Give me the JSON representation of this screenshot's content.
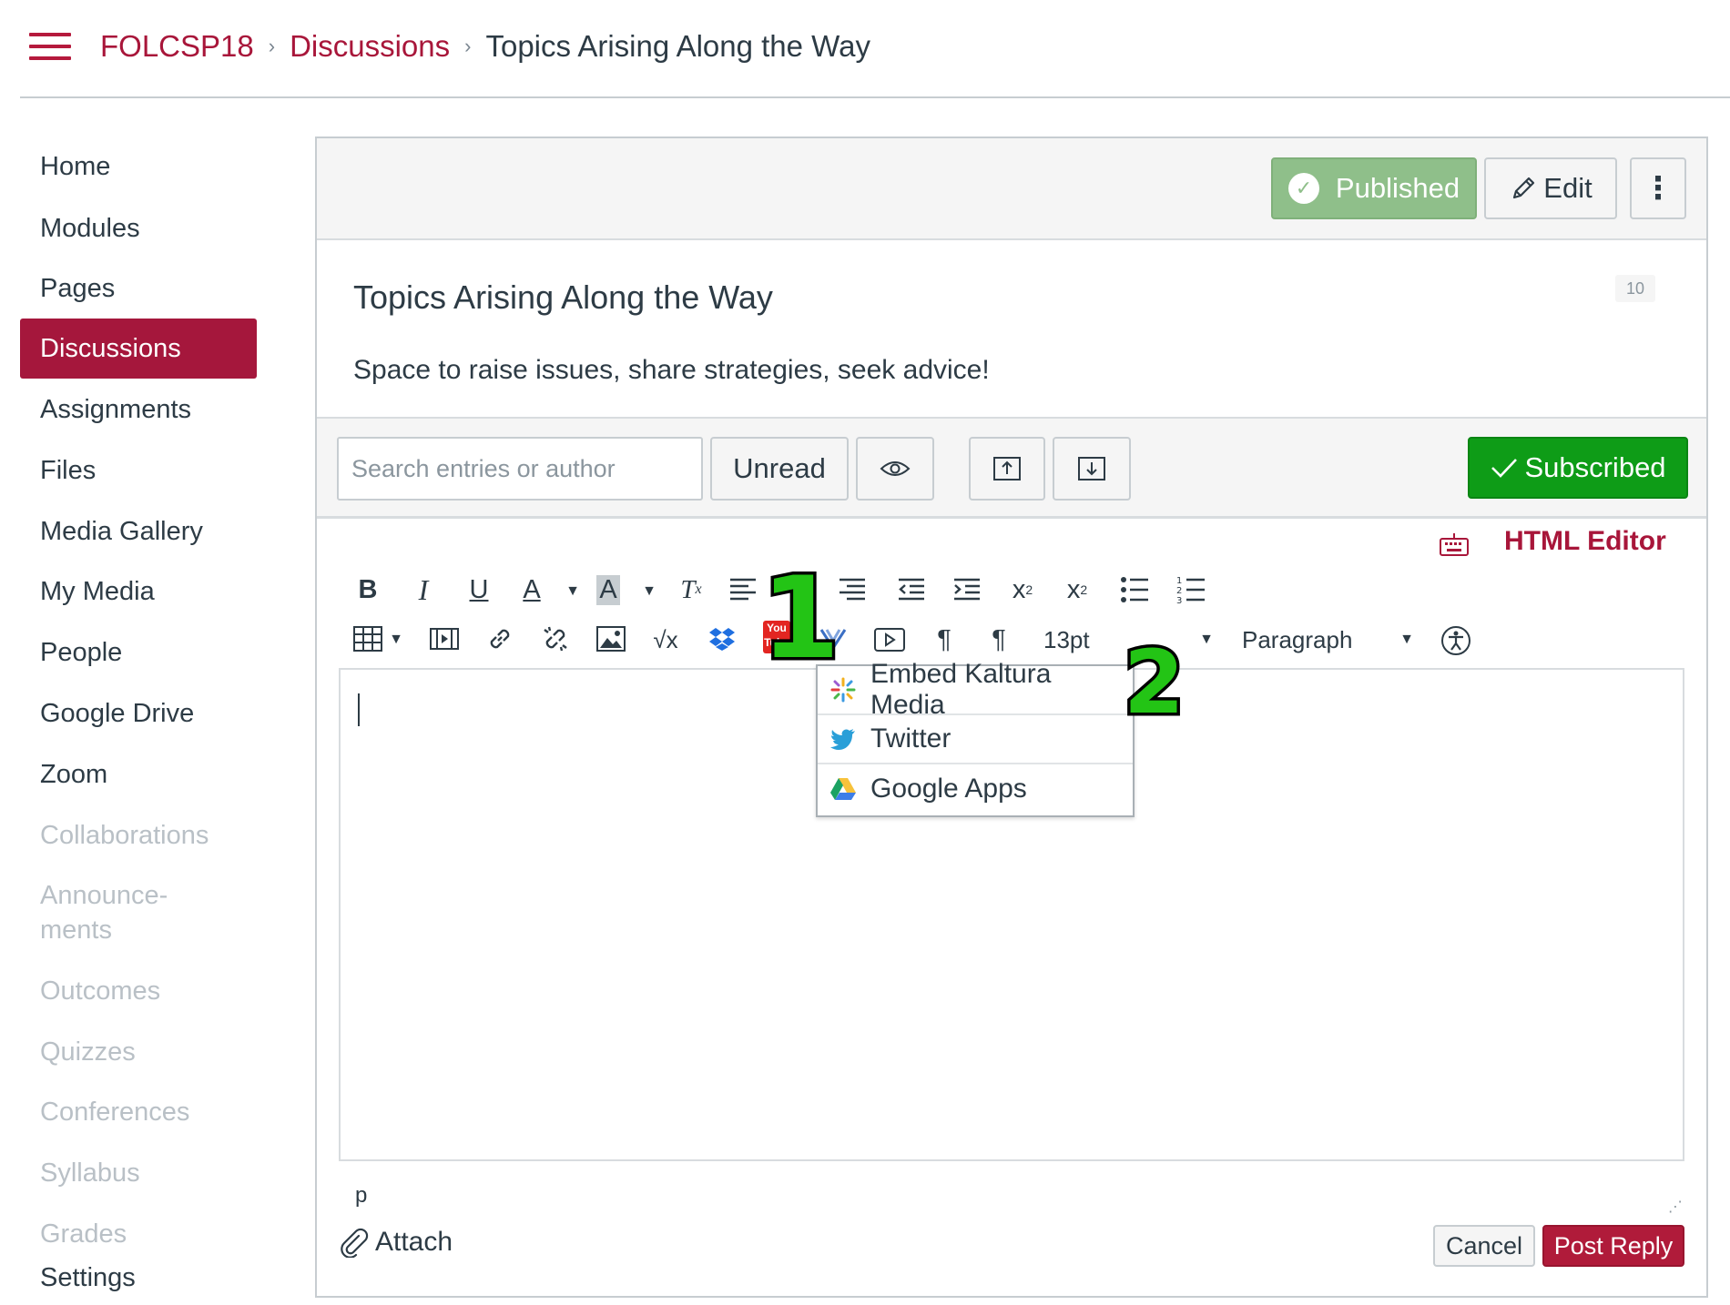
{
  "breadcrumb": {
    "course": "FOLCSP18",
    "section": "Discussions",
    "current": "Topics Arising Along the Way",
    "separator": "›"
  },
  "nav": {
    "items": [
      {
        "label": "Home",
        "state": "enabled"
      },
      {
        "label": "Modules",
        "state": "enabled"
      },
      {
        "label": "Pages",
        "state": "enabled"
      },
      {
        "label": "Discussions",
        "state": "active"
      },
      {
        "label": "Assignments",
        "state": "enabled"
      },
      {
        "label": "Files",
        "state": "enabled"
      },
      {
        "label": "Media Gallery",
        "state": "enabled"
      },
      {
        "label": "My Media",
        "state": "enabled"
      },
      {
        "label": "People",
        "state": "enabled"
      },
      {
        "label": "Google Drive",
        "state": "enabled"
      },
      {
        "label": "Zoom",
        "state": "enabled"
      },
      {
        "label": "Collaborations",
        "state": "disabled"
      },
      {
        "label": "Announce-\nments",
        "state": "disabled"
      },
      {
        "label": "Outcomes",
        "state": "disabled"
      },
      {
        "label": "Quizzes",
        "state": "disabled"
      },
      {
        "label": "Conferences",
        "state": "disabled"
      },
      {
        "label": "Syllabus",
        "state": "disabled"
      },
      {
        "label": "Grades",
        "state": "disabled"
      },
      {
        "label": "Settings",
        "state": "enabled"
      }
    ]
  },
  "topbar": {
    "published_label": "Published",
    "edit_label": "Edit",
    "more_label": "⋮"
  },
  "topic": {
    "title": "Topics Arising Along the Way",
    "badge": "10",
    "description": "Space to raise issues, share strategies, seek advice!"
  },
  "filters": {
    "search_placeholder": "Search entries or author",
    "unread_label": "Unread",
    "subscribed_label": "Subscribed"
  },
  "editor": {
    "html_editor_label": "HTML Editor",
    "font_size": "13pt",
    "block_format": "Paragraph",
    "path_element": "p",
    "toolbar_row1": [
      "bold-icon",
      "italic-icon",
      "underline-icon",
      "text-color-icon",
      "background-color-icon",
      "clear-formatting-icon",
      "align-left-icon",
      "align-center-icon",
      "align-right-icon",
      "outdent-icon",
      "indent-icon",
      "superscript-icon",
      "subscript-icon",
      "bullet-list-icon",
      "numbered-list-icon"
    ],
    "toolbar_row2": [
      "table-icon",
      "media-icon",
      "link-icon",
      "unlink-icon",
      "image-icon",
      "equation-icon",
      "dropbox-icon",
      "youtube-icon",
      "apps-chevron-icon",
      "video-icon",
      "ltr-icon",
      "rtl-icon",
      "accessibility-icon"
    ],
    "apps_menu": [
      {
        "label": "Embed Kaltura Media",
        "icon": "kaltura-icon"
      },
      {
        "label": "Twitter",
        "icon": "twitter-icon"
      },
      {
        "label": "Google Apps",
        "icon": "google-drive-icon"
      }
    ]
  },
  "annotations": {
    "step1": "1",
    "step2": "2"
  },
  "footer": {
    "attach_label": "Attach",
    "cancel_label": "Cancel",
    "post_label": "Post Reply"
  },
  "colors": {
    "brand": "#a8163a",
    "nav_active": "#a5173c",
    "published": "#8fbf8a",
    "subscribed": "#0e9c17",
    "post_reply": "#b01b3a",
    "step_marker": "#23c415"
  }
}
